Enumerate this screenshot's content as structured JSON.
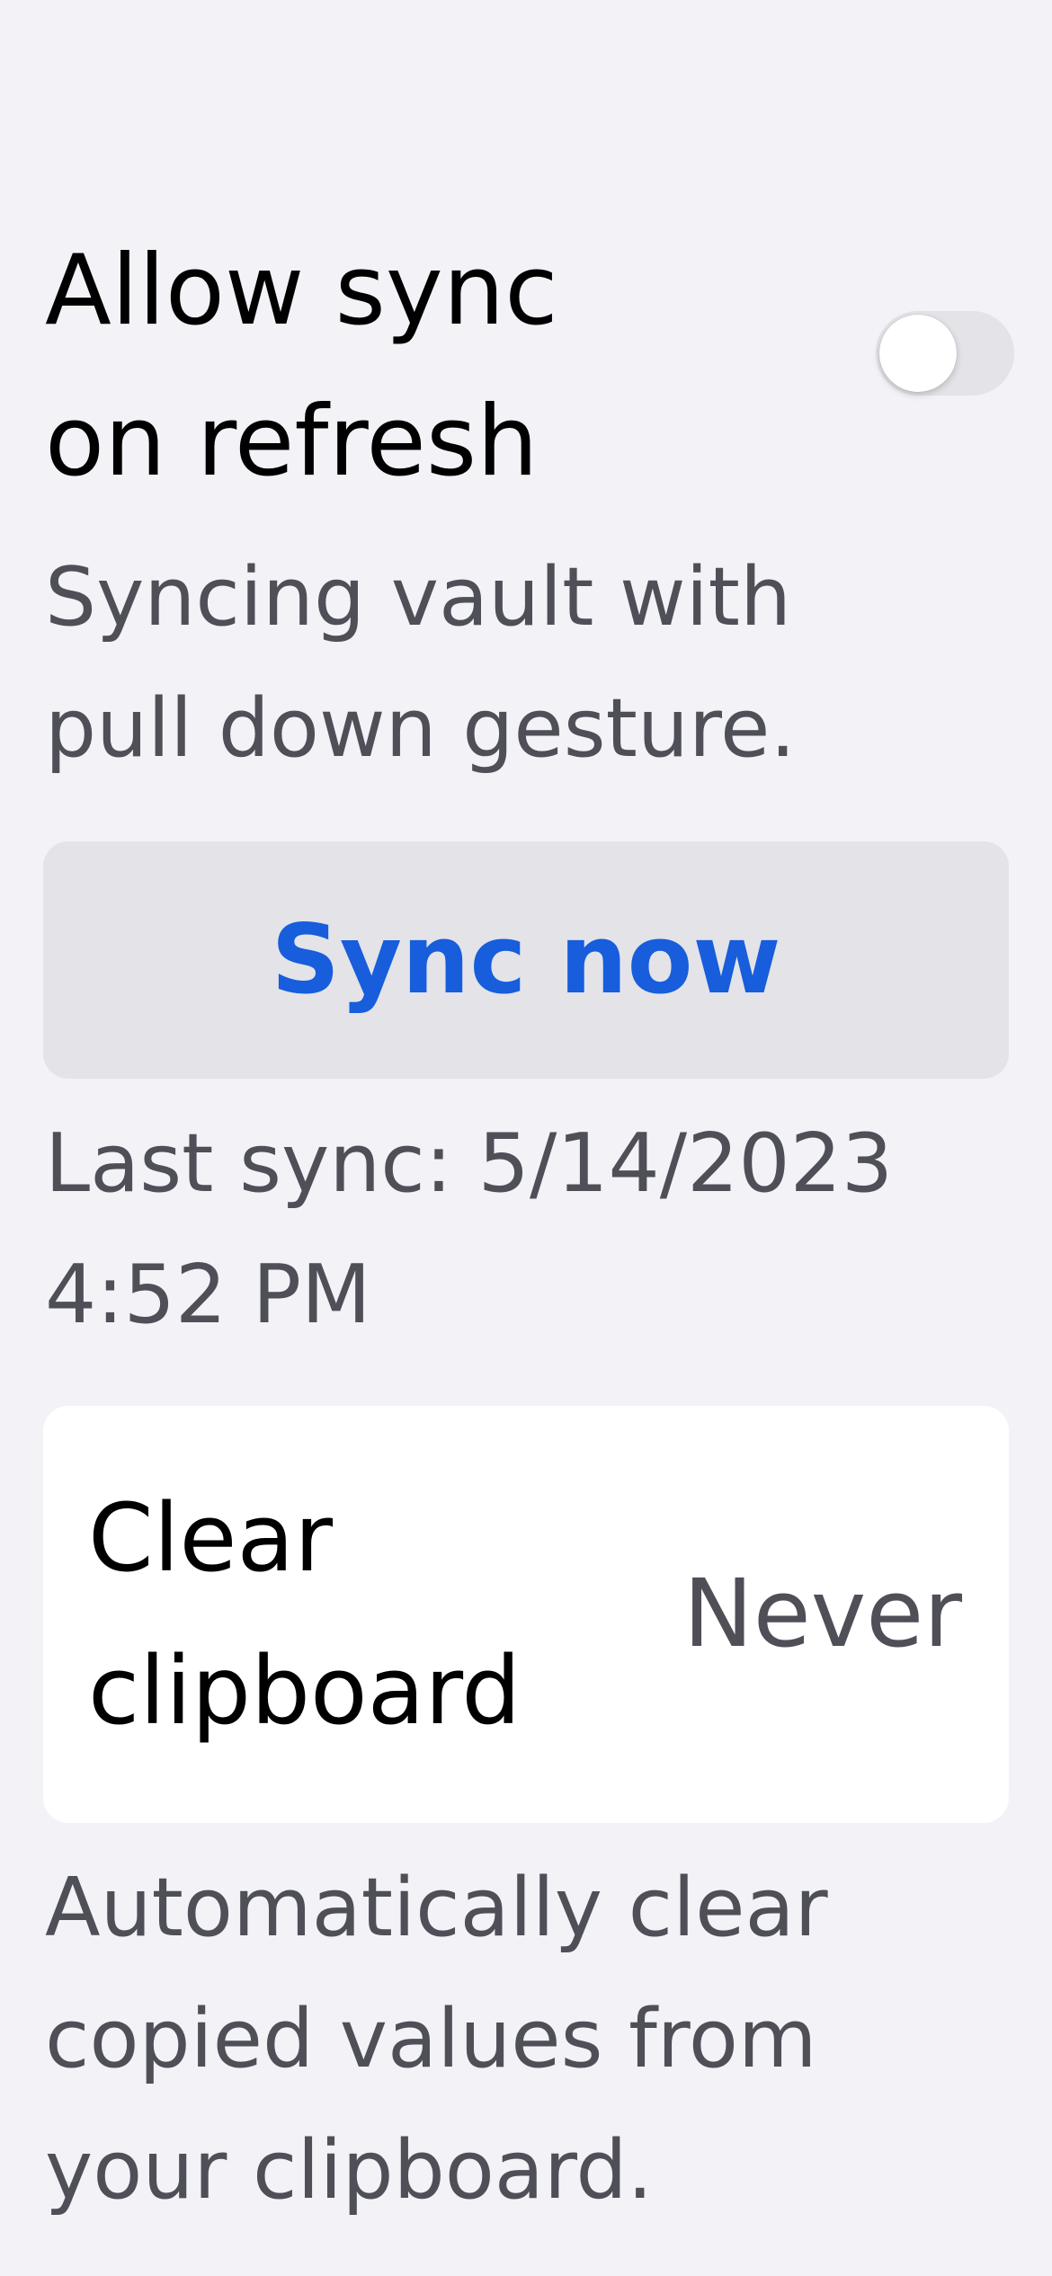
{
  "sync_on_refresh": {
    "title_lines": [
      "Allow sync",
      "on refresh"
    ],
    "enabled": false,
    "description_lines": [
      "Syncing vault with",
      "pull down gesture."
    ]
  },
  "sync_button": {
    "label": "Sync now"
  },
  "last_sync": {
    "lines": [
      "Last sync: 5/14/2023",
      "4:52 PM"
    ]
  },
  "clear_clipboard": {
    "label_lines": [
      "Clear",
      "clipboard"
    ],
    "value": "Never",
    "description_lines": [
      "Automatically clear",
      "copied values from",
      "your clipboard."
    ]
  },
  "colors": {
    "background": "#f2f2f7",
    "accent": "#175ddc",
    "secondary_text": "#4f4f58",
    "toggle_off": "#e3e3e8"
  }
}
